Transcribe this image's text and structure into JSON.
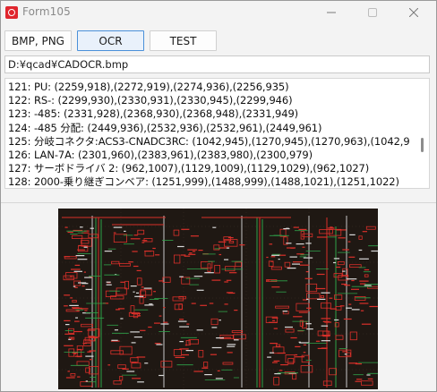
{
  "window": {
    "title": "Form105",
    "colors": {
      "icon": "#e0262e",
      "background": "#f3f3f3"
    },
    "controls": [
      "minimize-icon",
      "maximize-icon",
      "close-icon"
    ]
  },
  "toolbar": {
    "bmp_png_label": "BMP, PNG",
    "ocr_label": "OCR",
    "test_label": "TEST"
  },
  "path": {
    "value": "D:¥qcad¥CADOCR.bmp"
  },
  "results": {
    "lines": [
      "121: PU: (2259,918),(2272,919),(2274,936),(2256,935)",
      "122: RS-: (2299,930),(2330,931),(2330,945),(2299,946)",
      "123: -485: (2331,928),(2368,930),(2368,948),(2331,949)",
      "124: -485 分配: (2449,936),(2532,936),(2532,961),(2449,961)",
      "125: 分岐コネクタ:ACS3-CNADC3RC: (1042,945),(1270,945),(1270,963),(1042,9",
      "126: LAN-7A: (2301,960),(2383,961),(2383,980),(2300,979)",
      "127: サーボドライバ 2: (962,1007),(1129,1009),(1129,1029),(962,1027)",
      "128: 2000-乗り継ぎコンベア: (1251,999),(1488,999),(1488,1021),(1251,1022)"
    ]
  },
  "preview": {
    "description_icon": "cad-drawing-image",
    "colors": {
      "background": "#1f1813",
      "primary": "#d9302a",
      "secondary": "#2fa24a",
      "tertiary": "#d8d8d8"
    }
  }
}
